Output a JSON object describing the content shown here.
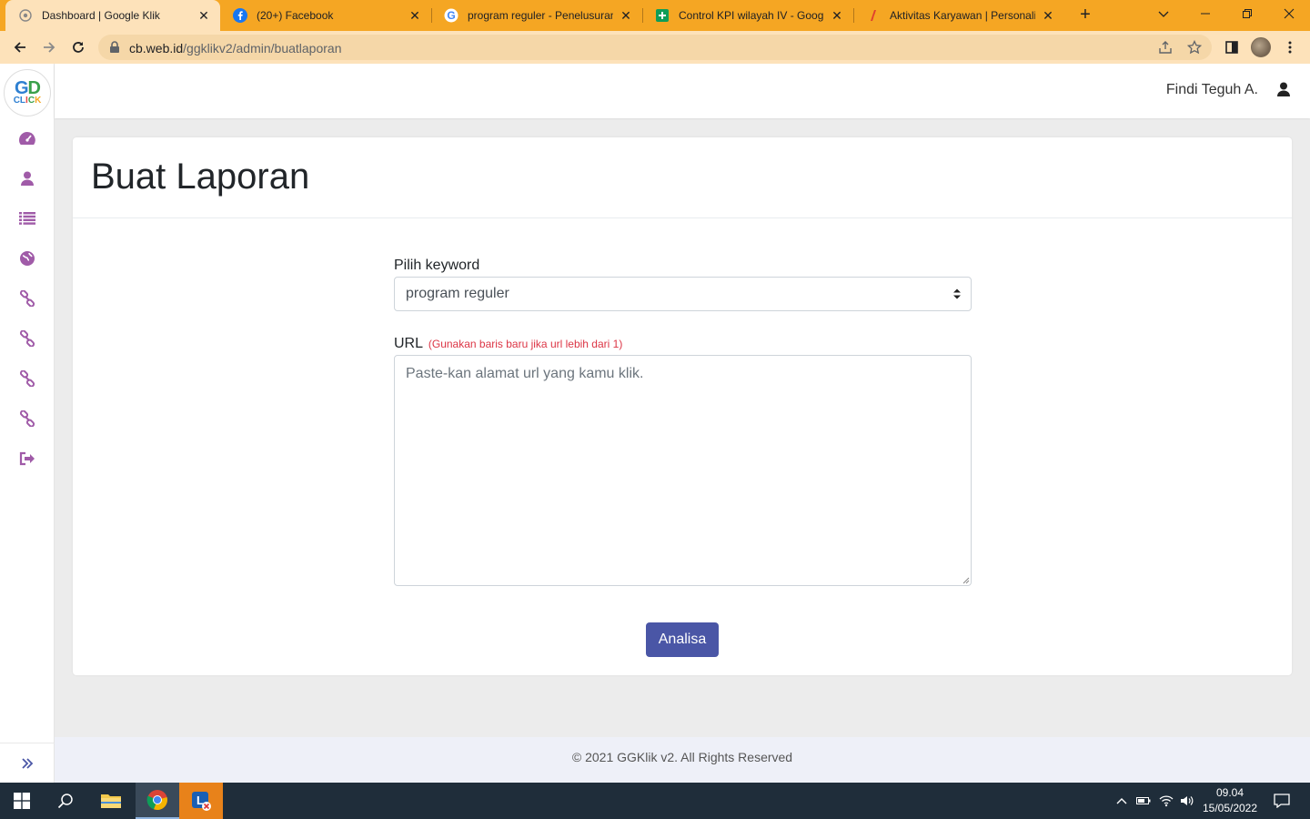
{
  "browser": {
    "tabs": [
      {
        "title": "Dashboard | Google Klik",
        "favicon": "gg-logo-icon",
        "active": true
      },
      {
        "title": "(20+) Facebook",
        "favicon": "facebook-icon",
        "active": false
      },
      {
        "title": "program reguler - Penelusuran",
        "favicon": "google-icon",
        "active": false
      },
      {
        "title": "Control KPI wilayah IV - Google",
        "favicon": "sheets-icon",
        "active": false
      },
      {
        "title": "Aktivitas Karyawan | Personalia",
        "favicon": "personalia-icon",
        "active": false
      }
    ],
    "url_host": "cb.web.id",
    "url_path": "/ggklikv2/admin/buatlaporan"
  },
  "logo": {
    "top": "GD",
    "bottom": "CLICK"
  },
  "header": {
    "user_name": "Findi Teguh A."
  },
  "sidebar": {
    "items": [
      {
        "icon": "dashboard-icon"
      },
      {
        "icon": "user-icon"
      },
      {
        "icon": "list-icon"
      },
      {
        "icon": "globe-icon"
      },
      {
        "icon": "link-icon"
      },
      {
        "icon": "link-icon"
      },
      {
        "icon": "link-icon"
      },
      {
        "icon": "link-icon"
      },
      {
        "icon": "sign-out-icon"
      }
    ],
    "accent": "#a05ba8"
  },
  "page": {
    "title": "Buat Laporan",
    "keyword_label": "Pilih keyword",
    "keyword_value": "program reguler",
    "url_label": "URL",
    "url_hint": "(Gunakan baris baru jika url lebih dari 1)",
    "url_placeholder": "Paste-kan alamat url yang kamu klik.",
    "submit_label": "Analisa"
  },
  "footer": {
    "text": "© 2021 GGKlik v2. All Rights Reserved"
  },
  "taskbar": {
    "time": "09.04",
    "date": "15/05/2022"
  },
  "colors": {
    "primary": "#4a56a6",
    "chrome_tabstrip": "#f5a623",
    "hint_red": "#dc3545"
  }
}
